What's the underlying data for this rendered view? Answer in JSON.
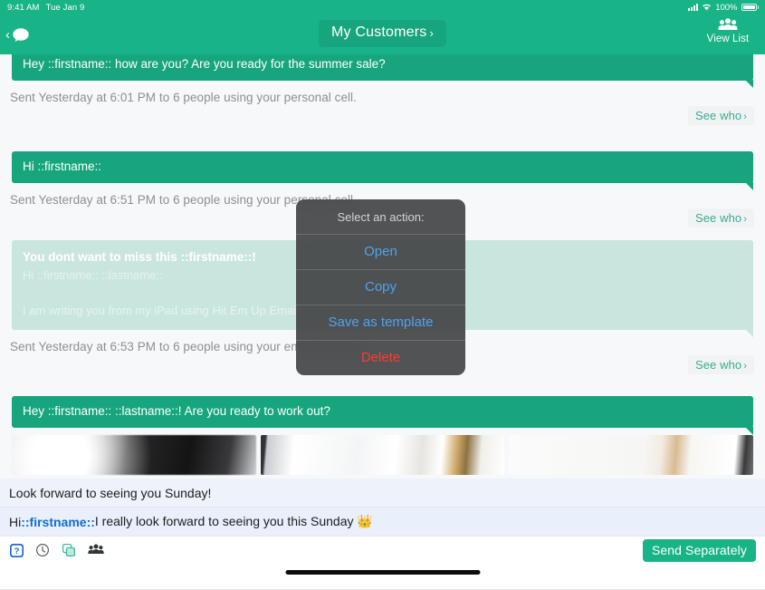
{
  "status_bar": {
    "time": "9:41 AM",
    "date": "Tue Jan 9",
    "battery": "100%",
    "signal_icon": "cellular-signal-icon",
    "wifi_icon": "wifi-icon",
    "battery_icon": "battery-full-icon"
  },
  "nav": {
    "back_chevron": "‹",
    "back_icon": "chat-bubble-icon",
    "title": "My Customers",
    "title_chevron": "›",
    "right_icon": "group-people-icon",
    "right_label": "View List"
  },
  "messages": [
    {
      "text": "Hey ::firstname:: how are you? Are you ready for the summer sale?",
      "sent_info": "Sent Yesterday at 6:01 PM to 6 people using your personal cell.",
      "see_who": "See who",
      "see_who_chevron": "›"
    },
    {
      "text": "Hi ::firstname::",
      "sent_info": "Sent Yesterday at 6:51 PM to 6 people using your personal cell.",
      "see_who": "See who",
      "see_who_chevron": "›"
    },
    {
      "subject": "You dont want to miss this ::firstname::!",
      "greeting": "Hi ::firstname:: ::lastname::",
      "body": "I am writing you from my iPad using Hit Em Up Email Mobile",
      "sent_info": "Sent Yesterday at 6:53 PM to 6 people using your email address.",
      "see_who": "See who",
      "see_who_chevron": "›"
    },
    {
      "text": "Hey ::firstname:: ::lastname::! Are you ready to work out?",
      "photos": [
        "photo-thumbnail-1",
        "photo-thumbnail-2",
        "photo-thumbnail-3"
      ]
    }
  ],
  "action_sheet": {
    "title": "Select an action:",
    "items": [
      {
        "label": "Open",
        "style": "default"
      },
      {
        "label": "Copy",
        "style": "default"
      },
      {
        "label": "Save as template",
        "style": "default"
      },
      {
        "label": "Delete",
        "style": "destructive"
      }
    ]
  },
  "compose": {
    "subject_value": "Look forward to seeing you Sunday!",
    "body_prefix": "Hi ",
    "body_token": "::firstname::",
    "body_suffix": " I really look forward to seeing you this Sunday 👑",
    "tools": [
      {
        "name": "help-question-icon"
      },
      {
        "name": "clock-schedule-icon"
      },
      {
        "name": "duplicate-copy-icon"
      },
      {
        "name": "group-people-icon"
      }
    ],
    "send_label": "Send Separately"
  },
  "colors": {
    "brand_green": "#19b388",
    "bubble_green": "#17a57e",
    "email_bubble": "#c9e6de",
    "sheet_blue": "#4ea3ef",
    "destructive_red": "#ff3b30",
    "token_blue": "#0f6fd6",
    "scroll_bg": "#f7f8fa"
  }
}
